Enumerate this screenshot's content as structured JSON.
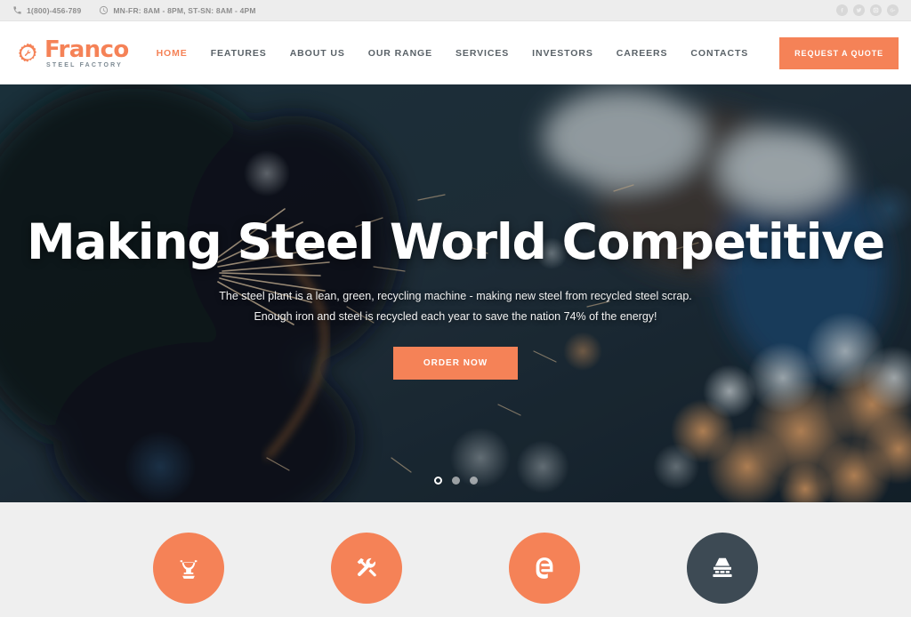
{
  "topbar": {
    "phone": "1(800)-456-789",
    "phone_icon": "phone-icon",
    "hours": "MN-FR: 8AM - 8PM, ST-SN: 8AM - 4PM",
    "hours_icon": "clock-icon",
    "socials": [
      {
        "name": "facebook-icon",
        "label": "f"
      },
      {
        "name": "twitter-icon",
        "label": "t"
      },
      {
        "name": "instagram-icon",
        "label": "i"
      },
      {
        "name": "google-plus-icon",
        "label": "g"
      }
    ]
  },
  "header": {
    "logo_name": "Franco",
    "logo_sub": "STEEL FACTORY",
    "logo_icon": "gear-wrench-icon",
    "nav": [
      {
        "label": "HOME",
        "active": true
      },
      {
        "label": "FEATURES",
        "active": false
      },
      {
        "label": "ABOUT US",
        "active": false
      },
      {
        "label": "OUR RANGE",
        "active": false
      },
      {
        "label": "SERVICES",
        "active": false
      },
      {
        "label": "INVESTORS",
        "active": false
      },
      {
        "label": "CAREERS",
        "active": false
      },
      {
        "label": "CONTACTS",
        "active": false
      }
    ],
    "quote_label": "REQUEST A QUOTE"
  },
  "hero": {
    "title": "Making Steel World Competitive",
    "subtitle_line1": "The steel plant is a lean, green, recycling machine - making new steel from recycled steel scrap.",
    "subtitle_line2": "Enough iron and steel is recycled each year to save the nation 74% of the energy!",
    "cta_label": "ORDER NOW",
    "slides": [
      {
        "active": true
      },
      {
        "active": false
      },
      {
        "active": false
      }
    ]
  },
  "features": [
    {
      "icon": "foundry-ladle-icon",
      "color": "#f58257"
    },
    {
      "icon": "hammer-wrench-icon",
      "color": "#f58257"
    },
    {
      "icon": "welding-helmet-icon",
      "color": "#f58257"
    },
    {
      "icon": "factory-furnace-icon",
      "color": "#3d4a54"
    }
  ],
  "colors": {
    "accent": "#f58257",
    "dark": "#3d4a54",
    "page_bg": "#efefef",
    "topbar_bg": "#ededed",
    "nav_text": "#5a6268"
  }
}
